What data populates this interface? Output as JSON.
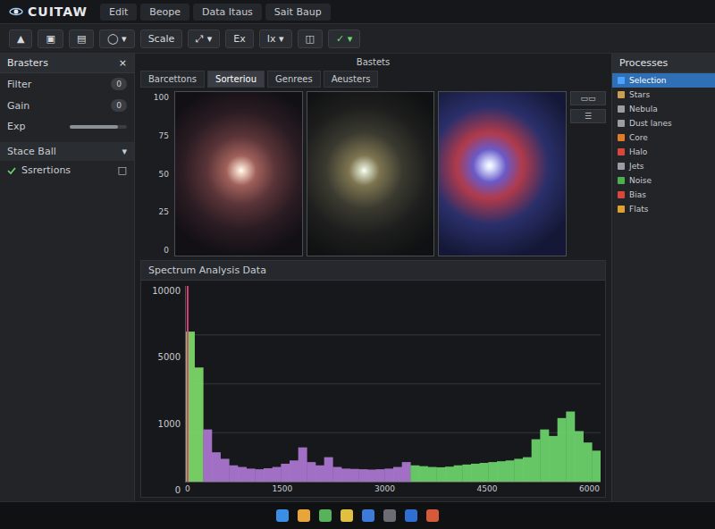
{
  "window": {
    "title": "CUITAW"
  },
  "menus": [
    "Edit",
    "Beope",
    "Data Itaus",
    "Sait Baup"
  ],
  "toolbar": {
    "buttons": [
      {
        "label": "▲",
        "accent": false
      },
      {
        "label": "▣",
        "accent": false
      },
      {
        "label": "▤",
        "accent": false
      },
      {
        "label": "◯ ▾",
        "accent": false
      },
      {
        "label": "Scale",
        "accent": false
      },
      {
        "label": "⤢ ▾",
        "accent": false
      },
      {
        "label": "Ex",
        "accent": false
      },
      {
        "label": "Ix ▾",
        "accent": false
      },
      {
        "label": "◫",
        "accent": false
      },
      {
        "label": "✓ ▾",
        "accent": true
      }
    ]
  },
  "left_panel": {
    "title": "Brasters",
    "close": "×",
    "rows": [
      {
        "kind": "toggle",
        "label": "Filter",
        "value": "0"
      },
      {
        "kind": "toggle",
        "label": "Gain",
        "value": "0"
      },
      {
        "kind": "slider",
        "label": "Exp",
        "level": 0.85
      }
    ],
    "section": {
      "title": "Stace Ball",
      "toggle": "▾"
    },
    "items": [
      {
        "label": "Ssrertions",
        "badge": "□"
      }
    ]
  },
  "viewer": {
    "title": "Bastets",
    "tabs": [
      {
        "label": "Barcettons",
        "selected": false
      },
      {
        "label": "Sorteriou",
        "selected": true
      },
      {
        "label": "Genrees",
        "selected": false
      },
      {
        "label": "Aeusters",
        "selected": false
      }
    ],
    "ticks": [
      "100",
      "75",
      "50",
      "25",
      "0"
    ],
    "side_buttons": [
      "▭▭",
      "☰"
    ]
  },
  "chart": {
    "title": "Spectrum Analysis Data",
    "y_ticks": [
      "10000",
      "5000",
      "1000",
      "0"
    ],
    "x_ticks": [
      "0",
      "1500",
      "3000",
      "4500",
      "6000"
    ],
    "y_max": 12000,
    "series": [
      {
        "name": "flux",
        "values": [
          9200,
          7000,
          3200,
          1800,
          1400,
          1000,
          900,
          800,
          760,
          820,
          900,
          1100,
          1300,
          2100,
          1200,
          1000,
          1500,
          900,
          800,
          780,
          760,
          740,
          760,
          800,
          900,
          1200,
          1000,
          950,
          900,
          880,
          920,
          1000,
          1050,
          1100,
          1150,
          1200,
          1250,
          1300,
          1400,
          1500,
          2600,
          3200,
          2800,
          3900,
          4300,
          3100,
          2400,
          1900
        ]
      }
    ]
  },
  "right_panel": {
    "title": "Processes",
    "items": [
      {
        "label": "Selection",
        "selected": true,
        "color": "#4aa3ff"
      },
      {
        "label": "Stars",
        "selected": false,
        "color": "#c8a050"
      },
      {
        "label": "Nebula",
        "selected": false,
        "color": "#9a9da3"
      },
      {
        "label": "Dust lanes",
        "selected": false,
        "color": "#9a9da3"
      },
      {
        "label": "Core",
        "selected": false,
        "color": "#e07b2a"
      },
      {
        "label": "Halo",
        "selected": false,
        "color": "#d9463b"
      },
      {
        "label": "Jets",
        "selected": false,
        "color": "#9a9da3"
      },
      {
        "label": "Noise",
        "selected": false,
        "color": "#4caf50"
      },
      {
        "label": "Bias",
        "selected": false,
        "color": "#d9463b"
      },
      {
        "label": "Flats",
        "selected": false,
        "color": "#e0a030"
      }
    ]
  },
  "taskbar": {
    "apps": [
      {
        "color": "#3a8ee6"
      },
      {
        "color": "#e8a53a"
      },
      {
        "color": "#56b35b"
      },
      {
        "color": "#e0c040"
      },
      {
        "color": "#3d7bd9"
      },
      {
        "color": "#6a6d73"
      },
      {
        "color": "#2e6fd1"
      },
      {
        "color": "#d65a3a"
      }
    ]
  }
}
